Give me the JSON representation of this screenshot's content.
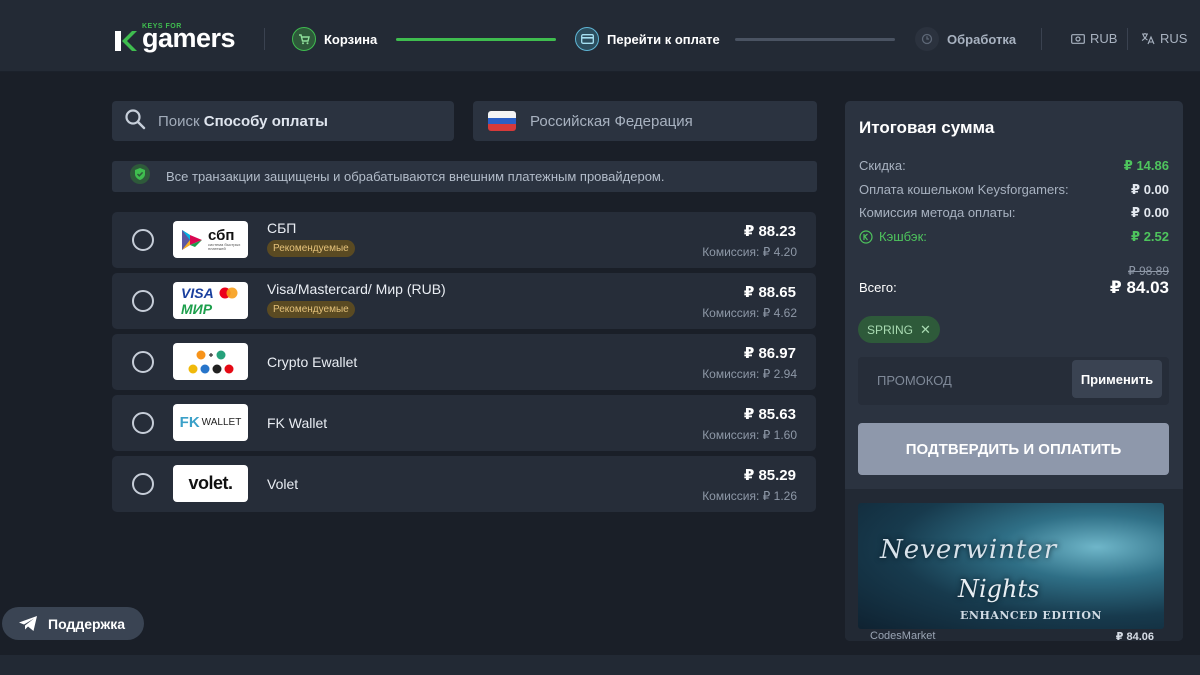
{
  "header": {
    "logo_small": "KEYS FOR",
    "logo_text": "gamers",
    "steps": [
      {
        "label": "Корзина",
        "state": "done",
        "icon": "cart-icon"
      },
      {
        "label": "Перейти к оплате",
        "state": "active",
        "icon": "card-icon"
      },
      {
        "label": "Обработка",
        "state": "pending",
        "icon": "processing-icon"
      }
    ],
    "currency": "RUB",
    "language": "RUS",
    "colors": {
      "accent": "#3fbd4f",
      "active": "#5fb6d6"
    }
  },
  "search": {
    "prefix": "Поиск",
    "label": "Способу оплаты"
  },
  "country": {
    "name": "Российская Федерация"
  },
  "notice": {
    "text": "Все транзакции защищены и обрабатываются внешним платежным провайдером."
  },
  "methods": [
    {
      "name": "СБП",
      "badge": "Рекомендуемые",
      "price": "₽ 88.23",
      "fee": "Комиссия: ₽ 4.20",
      "logo": "sbp-logo",
      "logo_text": "сбп",
      "logo_caption": "система быстрых платежей"
    },
    {
      "name": "Visa/Mastercard/ Мир (RUB)",
      "badge": "Рекомендуемые",
      "price": "₽ 88.65",
      "fee": "Комиссия: ₽ 4.62",
      "logo": "visa-mir-logo",
      "logo_text_1": "VISA",
      "logo_text_2": "МИР"
    },
    {
      "name": "Crypto Ewallet",
      "badge": "",
      "price": "₽ 86.97",
      "fee": "Комиссия: ₽ 2.94",
      "logo": "crypto-logo"
    },
    {
      "name": "FK Wallet",
      "badge": "",
      "price": "₽ 85.63",
      "fee": "Комиссия: ₽ 1.60",
      "logo": "fk-wallet-logo",
      "logo_text": "WALLET",
      "logo_mark": "FK"
    },
    {
      "name": "Volet",
      "badge": "",
      "price": "₽ 85.29",
      "fee": "Комиссия: ₽ 1.26",
      "logo": "volet-logo",
      "logo_text": "volet."
    }
  ],
  "summary": {
    "title": "Итоговая сумма",
    "rows": [
      {
        "label": "Скидка:",
        "value": "₽ 14.86",
        "green": true
      },
      {
        "label": "Оплата кошельком Keysforgamers:",
        "value": "₽ 0.00",
        "green": false
      },
      {
        "label": "Комиссия метода оплаты:",
        "value": "₽ 0.00",
        "green": false
      },
      {
        "label": "Кэшбэк:",
        "value": "₽ 2.52",
        "green": true,
        "icon": "cashback-icon"
      }
    ],
    "total_label": "Всего:",
    "old_price": "₽ 98.89",
    "total": "₽ 84.03",
    "coupon": "SPRING",
    "promo_placeholder": "ПРОМОКОД",
    "promo_button": "Применить",
    "confirm_button": "ПОДТВЕРДИТЬ И ОПЛАТИТЬ"
  },
  "game": {
    "title_line1": "Neverwinter",
    "title_line2": "Nights",
    "title_line3": "ENHANCED EDITION",
    "seller": "CodesMarket",
    "price": "₽ 84.06"
  },
  "support": {
    "label": "Поддержка"
  }
}
